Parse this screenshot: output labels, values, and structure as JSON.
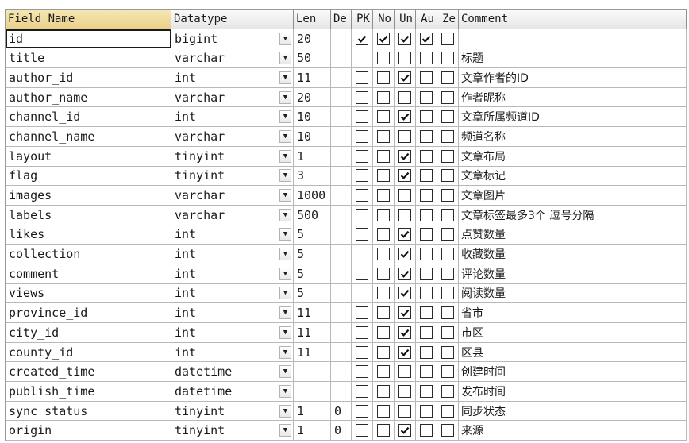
{
  "columns": [
    "Field Name",
    "Datatype",
    "Len",
    "De",
    "PK",
    "No",
    "Un",
    "Au",
    "Ze",
    "Comment"
  ],
  "dropdown_glyph": "▼",
  "rows": [
    {
      "name": "id",
      "type": "bigint",
      "len": "20",
      "def": "",
      "pk": true,
      "no": true,
      "un": true,
      "au": true,
      "ze": false,
      "comment": ""
    },
    {
      "name": "title",
      "type": "varchar",
      "len": "50",
      "def": "",
      "pk": false,
      "no": false,
      "un": false,
      "au": false,
      "ze": false,
      "comment": "标题"
    },
    {
      "name": "author_id",
      "type": "int",
      "len": "11",
      "def": "",
      "pk": false,
      "no": false,
      "un": true,
      "au": false,
      "ze": false,
      "comment": "文章作者的ID"
    },
    {
      "name": "author_name",
      "type": "varchar",
      "len": "20",
      "def": "",
      "pk": false,
      "no": false,
      "un": false,
      "au": false,
      "ze": false,
      "comment": "作者昵称"
    },
    {
      "name": "channel_id",
      "type": "int",
      "len": "10",
      "def": "",
      "pk": false,
      "no": false,
      "un": true,
      "au": false,
      "ze": false,
      "comment": "文章所属频道ID"
    },
    {
      "name": "channel_name",
      "type": "varchar",
      "len": "10",
      "def": "",
      "pk": false,
      "no": false,
      "un": false,
      "au": false,
      "ze": false,
      "comment": "频道名称"
    },
    {
      "name": "layout",
      "type": "tinyint",
      "len": "1",
      "def": "",
      "pk": false,
      "no": false,
      "un": true,
      "au": false,
      "ze": false,
      "comment": "文章布局"
    },
    {
      "name": "flag",
      "type": "tinyint",
      "len": "3",
      "def": "",
      "pk": false,
      "no": false,
      "un": true,
      "au": false,
      "ze": false,
      "comment": "文章标记"
    },
    {
      "name": "images",
      "type": "varchar",
      "len": "1000",
      "def": "",
      "pk": false,
      "no": false,
      "un": false,
      "au": false,
      "ze": false,
      "comment": "文章图片"
    },
    {
      "name": "labels",
      "type": "varchar",
      "len": "500",
      "def": "",
      "pk": false,
      "no": false,
      "un": false,
      "au": false,
      "ze": false,
      "comment": "文章标签最多3个 逗号分隔"
    },
    {
      "name": "likes",
      "type": "int",
      "len": "5",
      "def": "",
      "pk": false,
      "no": false,
      "un": true,
      "au": false,
      "ze": false,
      "comment": "点赞数量"
    },
    {
      "name": "collection",
      "type": "int",
      "len": "5",
      "def": "",
      "pk": false,
      "no": false,
      "un": true,
      "au": false,
      "ze": false,
      "comment": "收藏数量"
    },
    {
      "name": "comment",
      "type": "int",
      "len": "5",
      "def": "",
      "pk": false,
      "no": false,
      "un": true,
      "au": false,
      "ze": false,
      "comment": "评论数量"
    },
    {
      "name": "views",
      "type": "int",
      "len": "5",
      "def": "",
      "pk": false,
      "no": false,
      "un": true,
      "au": false,
      "ze": false,
      "comment": "阅读数量"
    },
    {
      "name": "province_id",
      "type": "int",
      "len": "11",
      "def": "",
      "pk": false,
      "no": false,
      "un": true,
      "au": false,
      "ze": false,
      "comment": "省市"
    },
    {
      "name": "city_id",
      "type": "int",
      "len": "11",
      "def": "",
      "pk": false,
      "no": false,
      "un": true,
      "au": false,
      "ze": false,
      "comment": "市区"
    },
    {
      "name": "county_id",
      "type": "int",
      "len": "11",
      "def": "",
      "pk": false,
      "no": false,
      "un": true,
      "au": false,
      "ze": false,
      "comment": "区县"
    },
    {
      "name": "created_time",
      "type": "datetime",
      "len": "",
      "def": "",
      "pk": false,
      "no": false,
      "un": false,
      "au": false,
      "ze": false,
      "comment": "创建时间"
    },
    {
      "name": "publish_time",
      "type": "datetime",
      "len": "",
      "def": "",
      "pk": false,
      "no": false,
      "un": false,
      "au": false,
      "ze": false,
      "comment": "发布时间"
    },
    {
      "name": "sync_status",
      "type": "tinyint",
      "len": "1",
      "def": "0",
      "pk": false,
      "no": false,
      "un": false,
      "au": false,
      "ze": false,
      "comment": "同步状态"
    },
    {
      "name": "origin",
      "type": "tinyint",
      "len": "1",
      "def": "0",
      "pk": false,
      "no": false,
      "un": true,
      "au": false,
      "ze": false,
      "comment": "来源"
    }
  ]
}
